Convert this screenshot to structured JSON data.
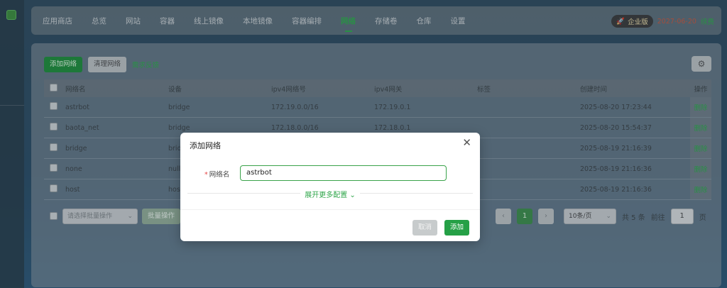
{
  "left_rail": {
    "icon": "app-icon"
  },
  "nav": {
    "items": [
      "应用商店",
      "总览",
      "网站",
      "容器",
      "线上镜像",
      "本地镜像",
      "容器编排",
      "网络",
      "存储卷",
      "仓库",
      "设置"
    ],
    "active": "网络",
    "enterprise_badge": "企业版",
    "expire_date": "2027-06-20",
    "renew": "续费"
  },
  "toolbar": {
    "add_network": "添加网络",
    "prune_network": "清理网络",
    "help_link": "需求反馈",
    "settings_icon": "gear-icon"
  },
  "table": {
    "headers": [
      "网络名",
      "设备",
      "ipv4网络号",
      "ipv4网关",
      "标签",
      "创建时间",
      "操作"
    ],
    "rows": [
      {
        "name": "astrbot",
        "device": "bridge",
        "subnet": "172.19.0.0/16",
        "gateway": "172.19.0.1",
        "tag": "",
        "created": "2025-08-20 17:23:44",
        "op": "删除"
      },
      {
        "name": "baota_net",
        "device": "bridge",
        "subnet": "172.18.0.0/16",
        "gateway": "172.18.0.1",
        "tag": "",
        "created": "2025-08-20 15:54:37",
        "op": "删除"
      },
      {
        "name": "bridge",
        "device": "brid",
        "subnet": "",
        "gateway": "",
        "tag": "",
        "created": "2025-08-19 21:16:39",
        "op": "删除"
      },
      {
        "name": "none",
        "device": "null",
        "subnet": "",
        "gateway": "",
        "tag": "",
        "created": "2025-08-19 21:16:36",
        "op": "删除"
      },
      {
        "name": "host",
        "device": "hos",
        "subnet": "",
        "gateway": "",
        "tag": "",
        "created": "2025-08-19 21:16:36",
        "op": "删除"
      }
    ]
  },
  "footer": {
    "batch_placeholder": "请选择批量操作",
    "batch_button": "批量操作",
    "prev": "‹",
    "page": "1",
    "next": "›",
    "page_size": "10条/页",
    "total": "共 5 条",
    "goto": "前往",
    "goto_value": "1",
    "page_unit": "页"
  },
  "dialog": {
    "title": "添加网络",
    "close": "✕",
    "field_label": "网络名",
    "field_value": "astrbot",
    "expand": "展开更多配置",
    "cancel": "取消",
    "submit": "添加"
  }
}
